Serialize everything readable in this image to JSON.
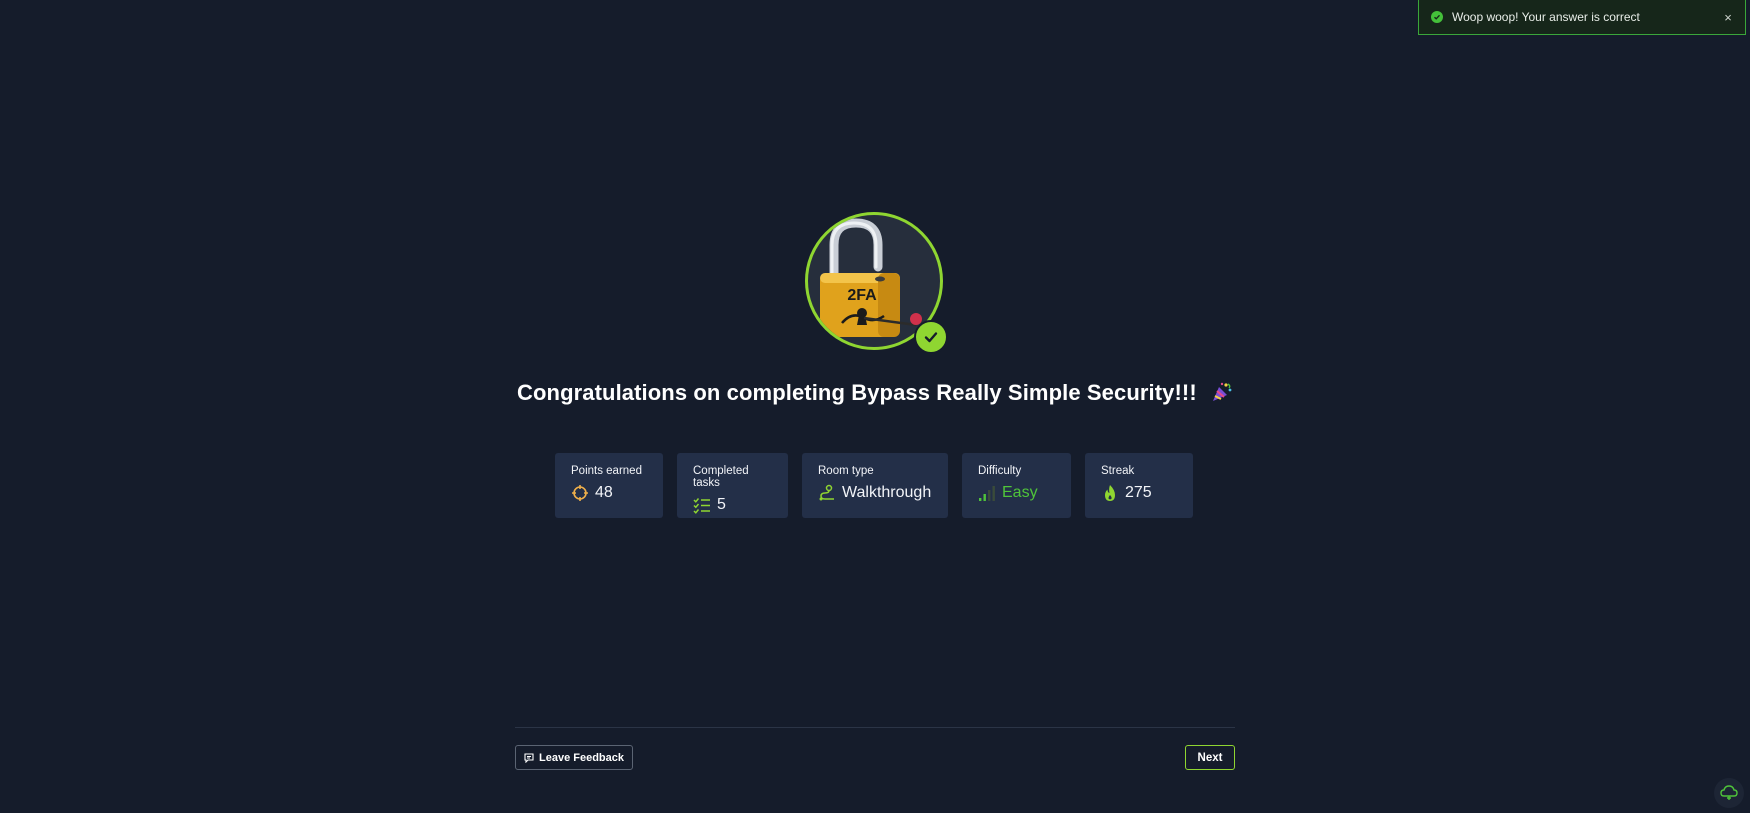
{
  "toast": {
    "message": "Woop woop! Your answer is correct",
    "close_label": "×"
  },
  "badge": {
    "lock_text": "2FA",
    "icon": "padlock-icon",
    "check_icon": "check-icon"
  },
  "title": {
    "text": "Congratulations on completing Bypass Really Simple Security!!!",
    "emoji": "party-popper-icon"
  },
  "stats": [
    {
      "label": "Points earned",
      "value": "48",
      "icon": "crosshair-icon"
    },
    {
      "label": "Completed tasks",
      "value": "5",
      "icon": "checklist-icon"
    },
    {
      "label": "Room type",
      "value": "Walkthrough",
      "icon": "path-icon"
    },
    {
      "label": "Difficulty",
      "value": "Easy",
      "icon": "signal-bars-icon"
    },
    {
      "label": "Streak",
      "value": "275",
      "icon": "flame-icon"
    }
  ],
  "footer": {
    "feedback_label": "Leave Feedback",
    "next_label": "Next"
  },
  "colors": {
    "background": "#151c2b",
    "accent_green": "#8fd631",
    "card_bg": "#232f48",
    "easy_green": "#4fc43a",
    "points_orange": "#f0b04a"
  }
}
